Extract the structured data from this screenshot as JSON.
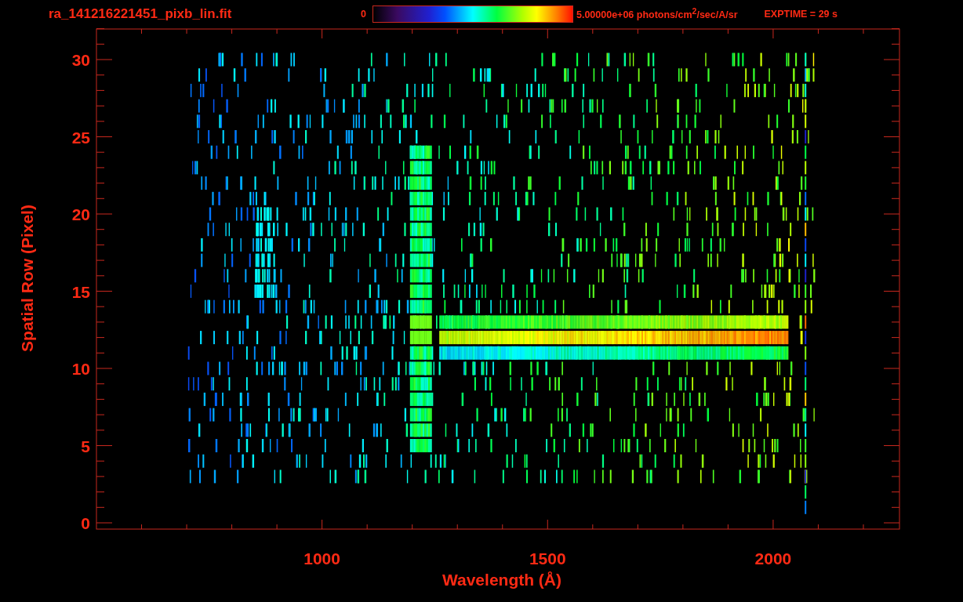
{
  "header": {
    "filename": "ra_141216221451_pixb_lin.fit",
    "colorbar": {
      "min_label": "0",
      "max_label": "5.00000e+06 photons/cm$^{2}$/sec/A/sr"
    },
    "exposure": "EXPTIME = 29 s"
  },
  "plot": {
    "x_axis": {
      "title": "Wavelength (Å)",
      "tick_labels": [
        "1000",
        "1500",
        "2000"
      ]
    },
    "y_axis": {
      "title": "Spatial Row (Pixel)",
      "tick_labels": [
        "30",
        "25",
        "20",
        "15",
        "10",
        "5",
        "0"
      ]
    }
  }
}
